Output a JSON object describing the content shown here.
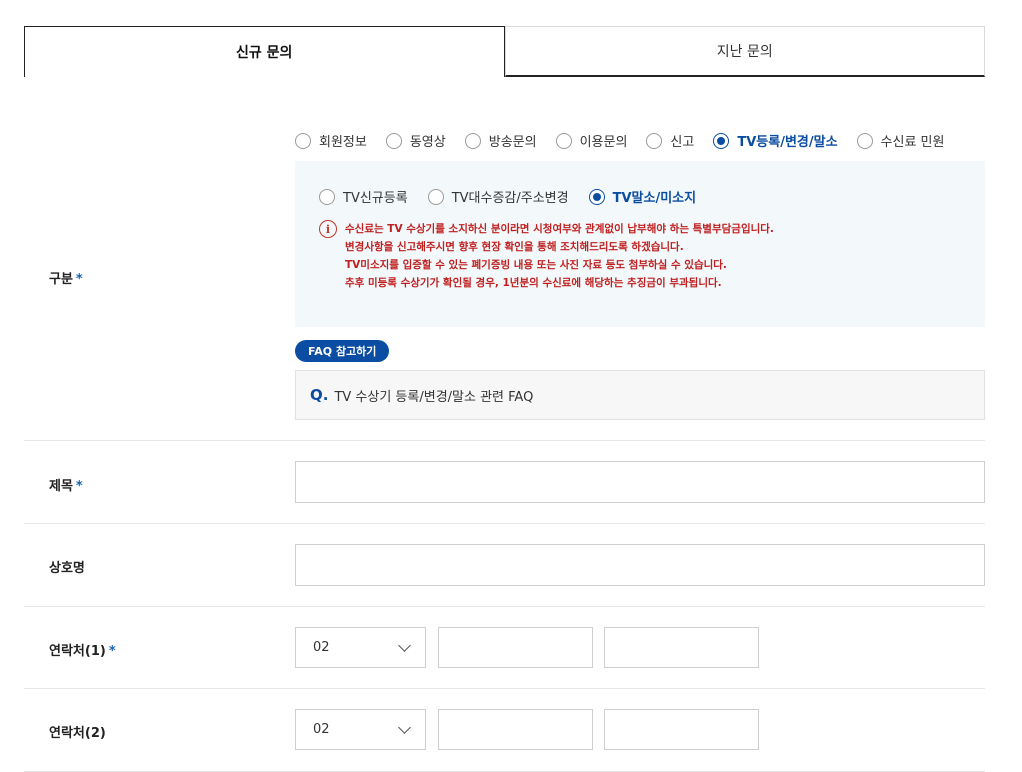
{
  "tabs": {
    "new": "신규 문의",
    "past": "지난 문의"
  },
  "category": {
    "label": "구분",
    "required_mark": "*",
    "options": [
      "회원정보",
      "동영상",
      "방송문의",
      "이용문의",
      "신고",
      "TV등록/변경/말소",
      "수신료 민원"
    ],
    "selected": "TV등록/변경/말소",
    "sub_options": [
      "TV신규등록",
      "TV대수증감/주소변경",
      "TV말소/미소지"
    ],
    "sub_selected": "TV말소/미소지",
    "notice_icon": "info-circle-icon",
    "notice_lines": [
      "수신료는 TV 수상기를 소지하신 분이라면 시청여부와 관계없이 납부해야 하는 특별부담금입니다.",
      "변경사항을 신고해주시면 향후 현장 확인을 통해 조치해드리도록 하겠습니다.",
      "TV미소지를 입증할 수 있는 폐기증빙 내용 또는 사진 자료 등도 첨부하실 수 있습니다.",
      "추후 미등록 수상기가 확인될 경우, 1년분의 수신료에 해당하는 추징금이 부과됩니다."
    ],
    "faq_badge": "FAQ 참고하기",
    "faq_q": "Q.",
    "faq_text": "TV 수상기 등록/변경/말소 관련 FAQ"
  },
  "title_field": {
    "label": "제목",
    "required_mark": "*",
    "value": ""
  },
  "company_field": {
    "label": "상호명",
    "value": ""
  },
  "contact1": {
    "label": "연락처(1)",
    "required_mark": "*",
    "prefix": "02",
    "mid": "",
    "last": ""
  },
  "contact2": {
    "label": "연락처(2)",
    "prefix": "02",
    "mid": "",
    "last": ""
  },
  "colors": {
    "accent": "#0b4da2",
    "notice": "#c0201f",
    "panel": "#f3f8fb"
  }
}
